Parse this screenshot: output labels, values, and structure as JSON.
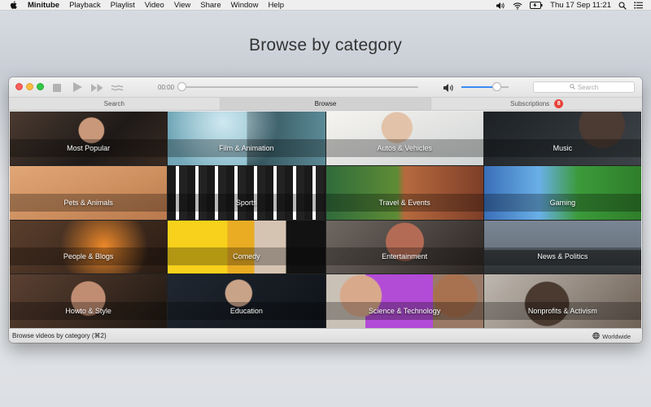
{
  "menubar": {
    "app_name": "Minitube",
    "items": [
      "Playback",
      "Playlist",
      "Video",
      "View",
      "Share",
      "Window",
      "Help"
    ],
    "datetime": "Thu 17 Sep  11:21"
  },
  "hero": {
    "title": "Browse by category"
  },
  "player": {
    "time": "00:00",
    "seek_position": 0.0,
    "volume_level": 0.75,
    "search_placeholder": "Search"
  },
  "tabs": [
    {
      "label": "Search",
      "active": false
    },
    {
      "label": "Browse",
      "active": true
    },
    {
      "label": "Subscriptions",
      "active": false,
      "badge": "8"
    }
  ],
  "categories": [
    {
      "label": "Most Popular"
    },
    {
      "label": "Film & Animation"
    },
    {
      "label": "Autos & Vehicles"
    },
    {
      "label": "Music"
    },
    {
      "label": "Pets & Animals"
    },
    {
      "label": "Sports"
    },
    {
      "label": "Travel & Events"
    },
    {
      "label": "Gaming"
    },
    {
      "label": "People & Blogs"
    },
    {
      "label": "Comedy"
    },
    {
      "label": "Entertainment"
    },
    {
      "label": "News & Politics"
    },
    {
      "label": "Howto & Style"
    },
    {
      "label": "Education"
    },
    {
      "label": "Science & Technology"
    },
    {
      "label": "Nonprofits & Activism"
    }
  ],
  "statusbar": {
    "text": "Browse videos by category (⌘2)",
    "region": "Worldwide"
  },
  "colors": {
    "accent": "#3b8bf5",
    "badge": "#e8433a"
  }
}
